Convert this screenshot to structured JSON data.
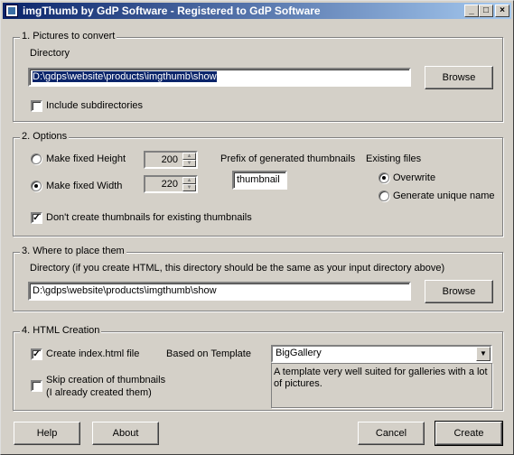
{
  "window": {
    "title": "imgThumb by GdP Software - Registered to GdP Software"
  },
  "titlebar_buttons": {
    "minimize": "_",
    "maximize": "□",
    "close": "×"
  },
  "pictures": {
    "legend": "1. Pictures to convert",
    "directory_label": "Directory",
    "directory_value": "D:\\gdps\\website\\products\\imgthumb\\show",
    "browse_label": "Browse",
    "include_subdirs_label": "Include subdirectories",
    "include_subdirs_checked": false
  },
  "options": {
    "legend": "2. Options",
    "fixed_height_label": "Make fixed Height",
    "fixed_height_value": "200",
    "fixed_width_label": "Make fixed Width",
    "fixed_width_value": "220",
    "selected_mode": "width",
    "prefix_label": "Prefix of generated thumbnails",
    "prefix_value": "thumbnail",
    "existing_files_label": "Existing files",
    "overwrite_label": "Overwrite",
    "unique_name_label": "Generate unique name",
    "existing_selected": "overwrite",
    "dont_create_label": "Don't create thumbnails for existing thumbnails",
    "dont_create_checked": true
  },
  "destination": {
    "legend": "3. Where to place them",
    "directory_label": "Directory (if you create HTML, this directory should be the same as your input directory above)",
    "directory_value": "D:\\gdps\\website\\products\\imgthumb\\show",
    "browse_label": "Browse"
  },
  "html": {
    "legend": "4. HTML Creation",
    "create_index_label": "Create index.html file",
    "create_index_checked": true,
    "based_on_label": "Based on Template",
    "template_value": "BigGallery",
    "template_description": "A template very well suited for galleries with a lot of pictures.",
    "skip_creation_label_line1": "Skip creation of thumbnails",
    "skip_creation_label_line2": "(I already created them)",
    "skip_creation_checked": false
  },
  "footer": {
    "help_label": "Help",
    "about_label": "About",
    "cancel_label": "Cancel",
    "create_label": "Create"
  }
}
